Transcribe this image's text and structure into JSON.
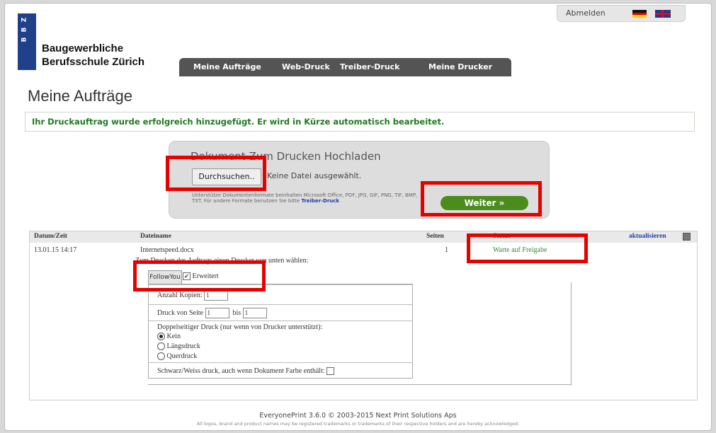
{
  "brand": {
    "logo_letters": [
      "B",
      "B",
      "Z"
    ],
    "line1": "Baugewerbliche",
    "line2": "Berufsschule Zürich"
  },
  "topbar": {
    "logout": "Abmelden",
    "languages": [
      "de-flag-icon",
      "uk-flag-icon"
    ]
  },
  "tabs": [
    "Meine Aufträge",
    "Web-Druck",
    "Treiber-Druck",
    "Meine Drucker"
  ],
  "page_title": "Meine Aufträge",
  "notice": "Ihr Druckauftrag wurde erfolgreich hinzugefügt. Er wird in Kürze automatisch bearbeitet.",
  "upload": {
    "title": "Dokument Zum Drucken Hochladen",
    "browse_label": "Durchsuchen..",
    "no_file": "Keine Datei ausgewählt.",
    "formats_text": "Unterstütze Dokumentenformate beinhalten Microsoft Office, PDF, JPG, GIF, PNG, TIF, BMP, TXT. Für andere Formate benutzen Sie bitte",
    "formats_link": "Treiber-Druck",
    "next_label": "Weiter »"
  },
  "jobs": {
    "headers": {
      "date": "Datum/Zeit",
      "file": "Dateiname",
      "pages": "Seiten",
      "status": "Status"
    },
    "refresh": "aktualisieren",
    "row": {
      "date": "13.01.15 14:17",
      "file": "Internetspeed.docx",
      "pages": "1",
      "status": "Warte auf Freigabe"
    },
    "choose_printer": "Zum Drucken des Auftrags einen Drucker von unten wählen:",
    "printer_button": "FollowYou",
    "advanced_label": "Erweitert",
    "copies_label": "Anzahl Kopien:",
    "copies_value": "1",
    "from_label": "Druck von Seite",
    "from_value": "1",
    "to_label": "bis",
    "to_value": "1",
    "duplex_label": "Doppelseitiger Druck (nur wenn von Drucker unterstützt):",
    "duplex_options": [
      "Kein",
      "Längsdruck",
      "Querdruck"
    ],
    "bw_label": "Schwarz/Weiss druck, auch wenn Dokument Farbe enthält:"
  },
  "footer": {
    "line1": "EveryonePrint 3.6.0 © 2003-2015 Next Print Solutions Aps",
    "line2": "All logos, brand and product names may be registered trademarks or trademarks of their respective holders and are hereby acknowledged."
  }
}
